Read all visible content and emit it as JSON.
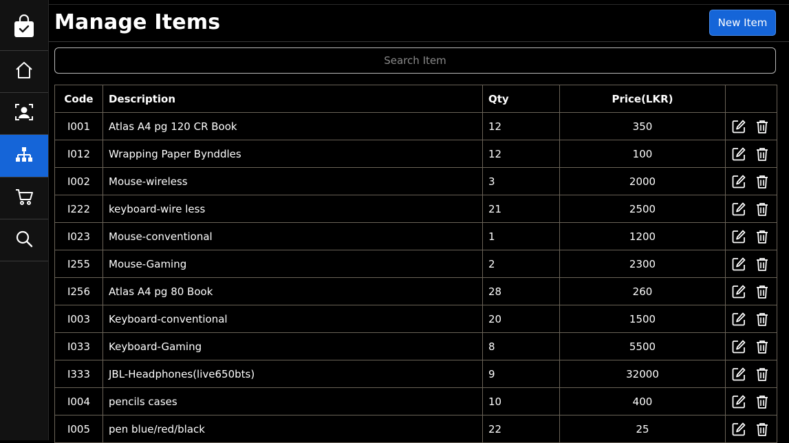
{
  "header": {
    "title": "Manage Items",
    "new_button": "New Item"
  },
  "search": {
    "placeholder": "Search Item"
  },
  "colors": {
    "accent": "#1565d8",
    "background": "#000000",
    "sidebar": "#121212"
  },
  "sidebar": {
    "items": [
      {
        "icon": "shopping-bag-icon"
      },
      {
        "icon": "home-icon"
      },
      {
        "icon": "customer-icon"
      },
      {
        "icon": "sitemap-icon",
        "active": true
      },
      {
        "icon": "cart-icon"
      },
      {
        "icon": "search-icon"
      }
    ]
  },
  "table": {
    "columns": [
      "Code",
      "Description",
      "Qty",
      "Price(LKR)",
      ""
    ],
    "action_icons": [
      "edit-icon",
      "trash-icon"
    ],
    "rows": [
      {
        "code": "I001",
        "description": "Atlas A4 pg 120 CR Book",
        "qty": "12",
        "price": "350"
      },
      {
        "code": "I012",
        "description": "Wrapping Paper Bynddles",
        "qty": "12",
        "price": "100"
      },
      {
        "code": "I002",
        "description": "Mouse-wireless",
        "qty": "3",
        "price": "2000"
      },
      {
        "code": "I222",
        "description": "keyboard-wire less",
        "qty": "21",
        "price": "2500"
      },
      {
        "code": "I023",
        "description": "Mouse-conventional",
        "qty": "1",
        "price": "1200"
      },
      {
        "code": "I255",
        "description": "Mouse-Gaming",
        "qty": "2",
        "price": "2300"
      },
      {
        "code": "I256",
        "description": "Atlas A4 pg 80 Book",
        "qty": "28",
        "price": "260"
      },
      {
        "code": "I003",
        "description": "Keyboard-conventional",
        "qty": "20",
        "price": "1500"
      },
      {
        "code": "I033",
        "description": "Keyboard-Gaming",
        "qty": "8",
        "price": "5500"
      },
      {
        "code": "I333",
        "description": "JBL-Headphones(live650bts)",
        "qty": "9",
        "price": "32000"
      },
      {
        "code": "I004",
        "description": "pencils cases",
        "qty": "10",
        "price": "400"
      },
      {
        "code": "I005",
        "description": "pen blue/red/black",
        "qty": "22",
        "price": "25"
      }
    ]
  }
}
